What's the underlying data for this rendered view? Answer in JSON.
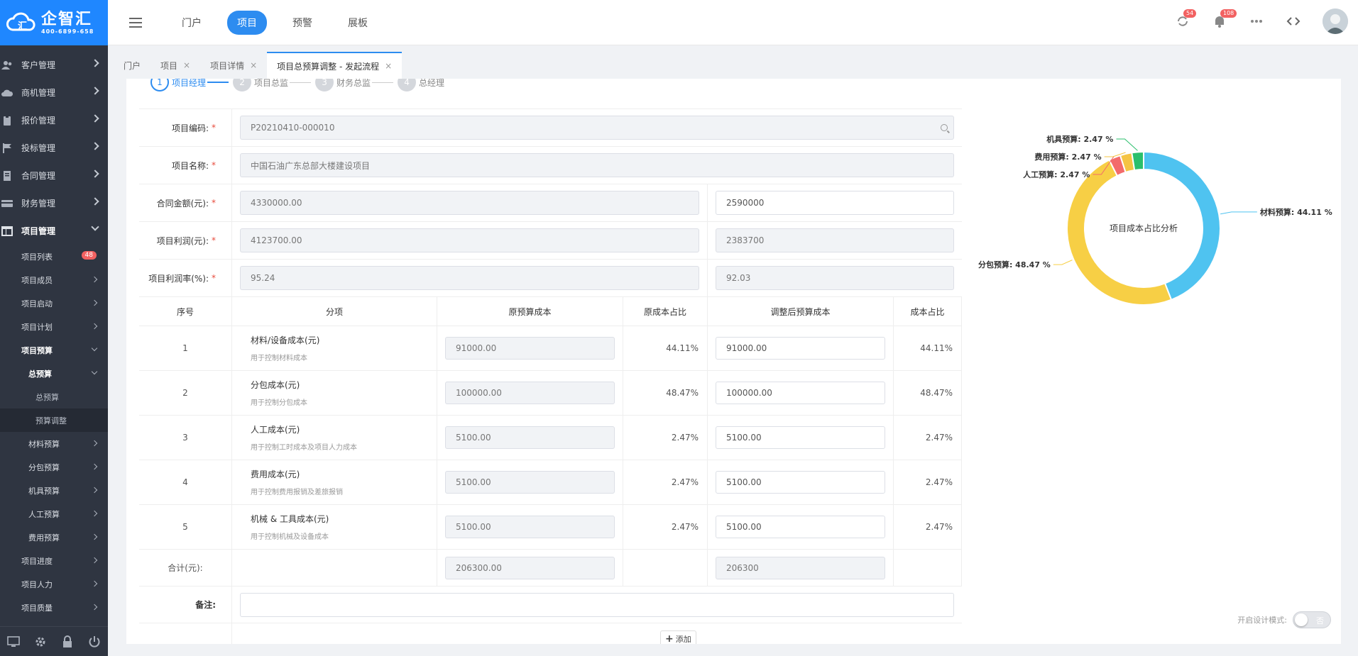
{
  "brand": {
    "name": "企智汇",
    "phone": "400-6899-658",
    "color": "#1f87ff"
  },
  "sidebar": {
    "items": [
      {
        "label": "客户管理",
        "icon": "users-icon"
      },
      {
        "label": "商机管理",
        "icon": "cloud-icon"
      },
      {
        "label": "报价管理",
        "icon": "clipboard-icon"
      },
      {
        "label": "投标管理",
        "icon": "flag-icon"
      },
      {
        "label": "合同管理",
        "icon": "document-icon"
      },
      {
        "label": "财务管理",
        "icon": "card-icon"
      },
      {
        "label": "项目管理",
        "icon": "layout-icon"
      }
    ],
    "project_sub": {
      "list": "项目列表",
      "list_badge": "48",
      "members": "项目成员",
      "start": "项目启动",
      "plan": "项目计划",
      "budget": "项目预算",
      "total_budget": "总预算",
      "total_budget_leaf": "总预算",
      "budget_adjust": "预算调整",
      "material": "材料预算",
      "subcontract": "分包预算",
      "machine": "机具预算",
      "labor": "人工预算",
      "expense": "费用预算",
      "progress": "项目进度",
      "manpower": "项目人力",
      "quality": "项目质量"
    }
  },
  "topbar": {
    "menu": [
      "门户",
      "项目",
      "预警",
      "展板"
    ],
    "active_index": 1,
    "sync_badge": "54",
    "bell_badge": "108"
  },
  "tabs": [
    {
      "label": "门户",
      "closable": false
    },
    {
      "label": "项目",
      "closable": true
    },
    {
      "label": "项目详情",
      "closable": true
    },
    {
      "label": "项目总预算调整 - 发起流程",
      "closable": true,
      "active": true
    }
  ],
  "steps": [
    {
      "num": "1",
      "label": "项目经理"
    },
    {
      "num": "2",
      "label": "项目总监"
    },
    {
      "num": "3",
      "label": "财务总监"
    },
    {
      "num": "4",
      "label": "总经理"
    }
  ],
  "form": {
    "code_label": "项目编码:",
    "code_value": "P20210410-000010",
    "name_label": "项目名称:",
    "name_value": "中国石油广东总部大楼建设项目",
    "contract_label": "合同金额(元):",
    "contract_orig": "4330000.00",
    "contract_adj": "2590000",
    "profit_label": "项目利润(元):",
    "profit_orig": "4123700.00",
    "profit_adj": "2383700",
    "rate_label": "项目利润率(%):",
    "rate_orig": "95.24",
    "rate_adj": "92.03",
    "required_mark": "*"
  },
  "table": {
    "headers": [
      "序号",
      "分项",
      "原预算成本",
      "原成本占比",
      "调整后预算成本",
      "成本占比"
    ],
    "rows": [
      {
        "idx": "1",
        "title": "材料/设备成本(元)",
        "desc": "用于控制材料成本",
        "orig": "91000.00",
        "orig_pct": "44.11%",
        "adj": "91000.00",
        "adj_pct": "44.11%"
      },
      {
        "idx": "2",
        "title": "分包成本(元)",
        "desc": "用于控制分包成本",
        "orig": "100000.00",
        "orig_pct": "48.47%",
        "adj": "100000.00",
        "adj_pct": "48.47%"
      },
      {
        "idx": "3",
        "title": "人工成本(元)",
        "desc": "用于控制工时成本及项目人力成本",
        "orig": "5100.00",
        "orig_pct": "2.47%",
        "adj": "5100.00",
        "adj_pct": "2.47%"
      },
      {
        "idx": "4",
        "title": "费用成本(元)",
        "desc": "用于控制费用报销及差旅报销",
        "orig": "5100.00",
        "orig_pct": "2.47%",
        "adj": "5100.00",
        "adj_pct": "2.47%"
      },
      {
        "idx": "5",
        "title": "机械 & 工具成本(元)",
        "desc": "用于控制机械及设备成本",
        "orig": "5100.00",
        "orig_pct": "2.47%",
        "adj": "5100.00",
        "adj_pct": "2.47%"
      }
    ],
    "total_label": "合计(元):",
    "total_orig": "206300.00",
    "total_adj": "206300",
    "note_label": "备注:",
    "add_label": "添加"
  },
  "chart_data": {
    "type": "pie",
    "title": "项目成本占比分析",
    "slices": [
      {
        "label": "材料预算: 44.11 %",
        "value": 44.11,
        "color": "#4fc3f0"
      },
      {
        "label": "分包预算: 48.47 %",
        "value": 48.47,
        "color": "#f7cf45"
      },
      {
        "label": "人工预算: 2.47 %",
        "value": 2.47,
        "color": "#f36b6b"
      },
      {
        "label": "费用预算: 2.47 %",
        "value": 2.47,
        "color": "#f5c443"
      },
      {
        "label": "机具预算: 2.47 %",
        "value": 2.47,
        "color": "#2bbf6c"
      }
    ]
  },
  "design_mode": {
    "label": "开启设计模式:",
    "state": "否"
  }
}
